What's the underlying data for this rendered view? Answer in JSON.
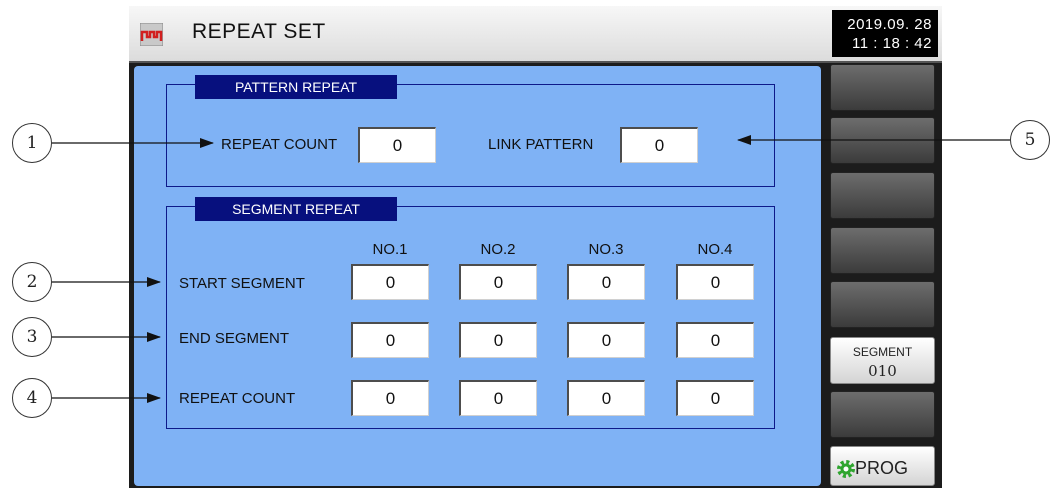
{
  "titlebar": {
    "title": "REPEAT SET",
    "date": "2019.09. 28",
    "time": "11 : 18 : 42"
  },
  "pattern_repeat": {
    "group_label": "PATTERN REPEAT",
    "repeat_count_label": "REPEAT COUNT",
    "repeat_count_value": "0",
    "link_pattern_label": "LINK PATTERN",
    "link_pattern_value": "0"
  },
  "segment_repeat": {
    "group_label": "SEGMENT REPEAT",
    "columns": [
      "NO.1",
      "NO.2",
      "NO.3",
      "NO.4"
    ],
    "rows": [
      {
        "label": "START SEGMENT",
        "values": [
          "0",
          "0",
          "0",
          "0"
        ]
      },
      {
        "label": "END SEGMENT",
        "values": [
          "0",
          "0",
          "0",
          "0"
        ]
      },
      {
        "label": "REPEAT COUNT",
        "values": [
          "0",
          "0",
          "0",
          "0"
        ]
      }
    ]
  },
  "side": {
    "segment_label": "SEGMENT",
    "segment_value": "010",
    "prog_label": "PROG"
  },
  "callouts": [
    "1",
    "2",
    "3",
    "4",
    "5"
  ],
  "colors": {
    "panel": "#7fb2f5",
    "group_tag": "#07107e",
    "prog_icon": "#2ea52e"
  }
}
